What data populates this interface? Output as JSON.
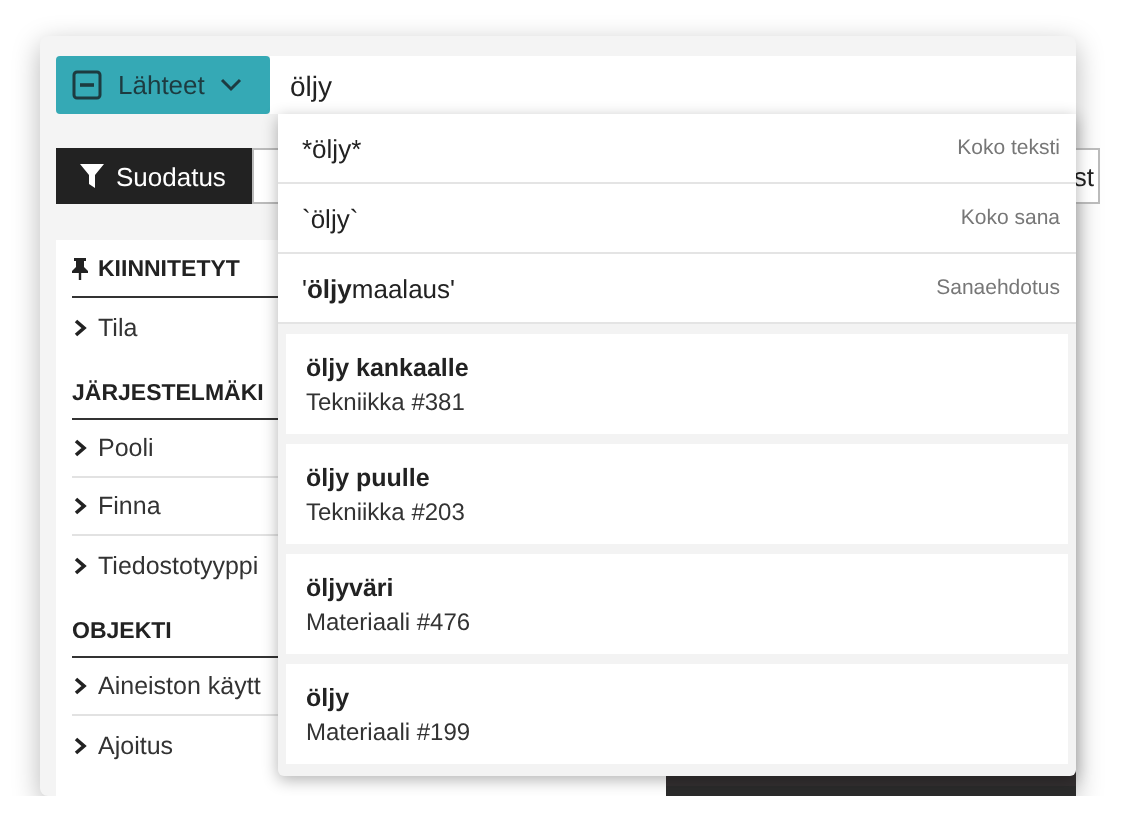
{
  "search": {
    "sources_button": "Lähteet",
    "value": "öljy"
  },
  "toolbar": {
    "filter_button": "Suodatus",
    "column_2": "st"
  },
  "sidebar": [
    {
      "title": "KIINNITETYT",
      "pinned": true,
      "items": [
        {
          "label": "Tila",
          "expanded": false
        }
      ]
    },
    {
      "title": "JÄRJESTELMÄKI",
      "pinned": false,
      "items": [
        {
          "label": "Pooli",
          "expanded": false
        },
        {
          "label": "Finna",
          "expanded": false
        },
        {
          "label": "Tiedostotyyppi",
          "expanded": false
        }
      ]
    },
    {
      "title": "OBJEKTI",
      "pinned": false,
      "items": [
        {
          "label": "Aineiston käytt",
          "expanded": false
        },
        {
          "label": "Ajoitus",
          "expanded": false
        }
      ]
    }
  ],
  "suggestions": [
    {
      "kind": "query",
      "parts": [
        {
          "text": "*öljy*",
          "bold": false
        }
      ],
      "type_label": "Koko teksti"
    },
    {
      "kind": "query",
      "parts": [
        {
          "text": "`öljy`",
          "bold": false
        }
      ],
      "type_label": "Koko sana"
    },
    {
      "kind": "query",
      "parts": [
        {
          "text": "'",
          "bold": false
        },
        {
          "text": "öljy",
          "bold": true
        },
        {
          "text": "maalaus'",
          "bold": false
        }
      ],
      "type_label": "Sanaehdotus"
    },
    {
      "kind": "term",
      "title": "öljy kankaalle",
      "subtitle": "Tekniikka #381"
    },
    {
      "kind": "term",
      "title": "öljy puulle",
      "subtitle": "Tekniikka #203"
    },
    {
      "kind": "term",
      "title": "öljyväri",
      "subtitle": "Materiaali #476"
    },
    {
      "kind": "term",
      "title": "öljy",
      "subtitle": "Materiaali #199"
    }
  ]
}
